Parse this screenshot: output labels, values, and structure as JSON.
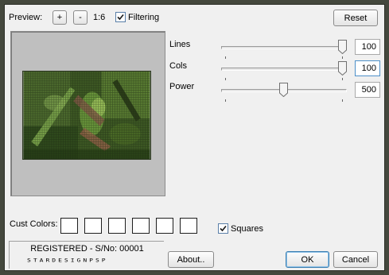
{
  "preview": {
    "label": "Preview:",
    "zoom_in_label": "+",
    "zoom_out_label": "-",
    "zoom_value": "1:6",
    "filtering_label": "Filtering",
    "filtering_checked": true
  },
  "reset_label": "Reset",
  "sliders": [
    {
      "label": "Lines",
      "value": "100"
    },
    {
      "label": "Cols",
      "value": "100"
    },
    {
      "label": "Power",
      "value": "500"
    }
  ],
  "cust_colors": {
    "label": "Cust Colors:",
    "swatches": [
      "#ffffff",
      "#ffffff",
      "#ffffff",
      "#ffffff",
      "#ffffff",
      "#ffffff"
    ]
  },
  "squares": {
    "label": "Squares",
    "checked": true
  },
  "registration": {
    "line1": "REGISTERED - S/No: 00001",
    "line2": "STARDESIGNPSP"
  },
  "buttons": {
    "about": "About..",
    "ok": "OK",
    "cancel": "Cancel"
  },
  "colors": {
    "accent": "#3c7fb1",
    "frame": "#44483d",
    "dialog": "#f0f0f0"
  }
}
